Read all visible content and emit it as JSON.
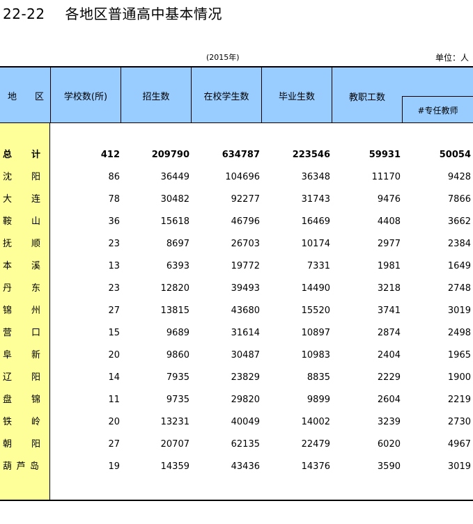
{
  "title": {
    "number": "22-22",
    "text": "各地区普通高中基本情况"
  },
  "year_note": "(2015年)",
  "unit_note": "单位：人",
  "headers": {
    "region": [
      "地",
      "区"
    ],
    "schools": "学校数(所)",
    "enrollment": "招生数",
    "students": "在校学生数",
    "graduates": "毕业生数",
    "staff": "教职工数",
    "teachers": "#专任教师"
  },
  "rows": [
    {
      "name": [
        "总",
        "计"
      ],
      "schools": "412",
      "enrollment": "209790",
      "students": "634787",
      "graduates": "223546",
      "staff": "59931",
      "teachers": "50054"
    },
    {
      "name": [
        "沈",
        "阳"
      ],
      "schools": "86",
      "enrollment": "36449",
      "students": "104696",
      "graduates": "36348",
      "staff": "11170",
      "teachers": "9428"
    },
    {
      "name": [
        "大",
        "连"
      ],
      "schools": "78",
      "enrollment": "30482",
      "students": "92277",
      "graduates": "31743",
      "staff": "9476",
      "teachers": "7866"
    },
    {
      "name": [
        "鞍",
        "山"
      ],
      "schools": "36",
      "enrollment": "15618",
      "students": "46796",
      "graduates": "16469",
      "staff": "4408",
      "teachers": "3662"
    },
    {
      "name": [
        "抚",
        "顺"
      ],
      "schools": "23",
      "enrollment": "8697",
      "students": "26703",
      "graduates": "10174",
      "staff": "2977",
      "teachers": "2384"
    },
    {
      "name": [
        "本",
        "溪"
      ],
      "schools": "13",
      "enrollment": "6393",
      "students": "19772",
      "graduates": "7331",
      "staff": "1981",
      "teachers": "1649"
    },
    {
      "name": [
        "丹",
        "东"
      ],
      "schools": "23",
      "enrollment": "12820",
      "students": "39493",
      "graduates": "14490",
      "staff": "3218",
      "teachers": "2748"
    },
    {
      "name": [
        "锦",
        "州"
      ],
      "schools": "27",
      "enrollment": "13815",
      "students": "43680",
      "graduates": "15520",
      "staff": "3741",
      "teachers": "3019"
    },
    {
      "name": [
        "营",
        "口"
      ],
      "schools": "15",
      "enrollment": "9689",
      "students": "31614",
      "graduates": "10897",
      "staff": "2874",
      "teachers": "2498"
    },
    {
      "name": [
        "阜",
        "新"
      ],
      "schools": "20",
      "enrollment": "9860",
      "students": "30487",
      "graduates": "10983",
      "staff": "2404",
      "teachers": "1965"
    },
    {
      "name": [
        "辽",
        "阳"
      ],
      "schools": "14",
      "enrollment": "7935",
      "students": "23829",
      "graduates": "8835",
      "staff": "2229",
      "teachers": "1900"
    },
    {
      "name": [
        "盘",
        "锦"
      ],
      "schools": "11",
      "enrollment": "9735",
      "students": "29820",
      "graduates": "9899",
      "staff": "2604",
      "teachers": "2219"
    },
    {
      "name": [
        "铁",
        "岭"
      ],
      "schools": "20",
      "enrollment": "13231",
      "students": "40049",
      "graduates": "14002",
      "staff": "3239",
      "teachers": "2730"
    },
    {
      "name": [
        "朝",
        "阳"
      ],
      "schools": "27",
      "enrollment": "20707",
      "students": "62135",
      "graduates": "22479",
      "staff": "6020",
      "teachers": "4967"
    },
    {
      "name": [
        "葫",
        "芦",
        "岛"
      ],
      "schools": "19",
      "enrollment": "14359",
      "students": "43436",
      "graduates": "14376",
      "staff": "3590",
      "teachers": "3019"
    }
  ]
}
